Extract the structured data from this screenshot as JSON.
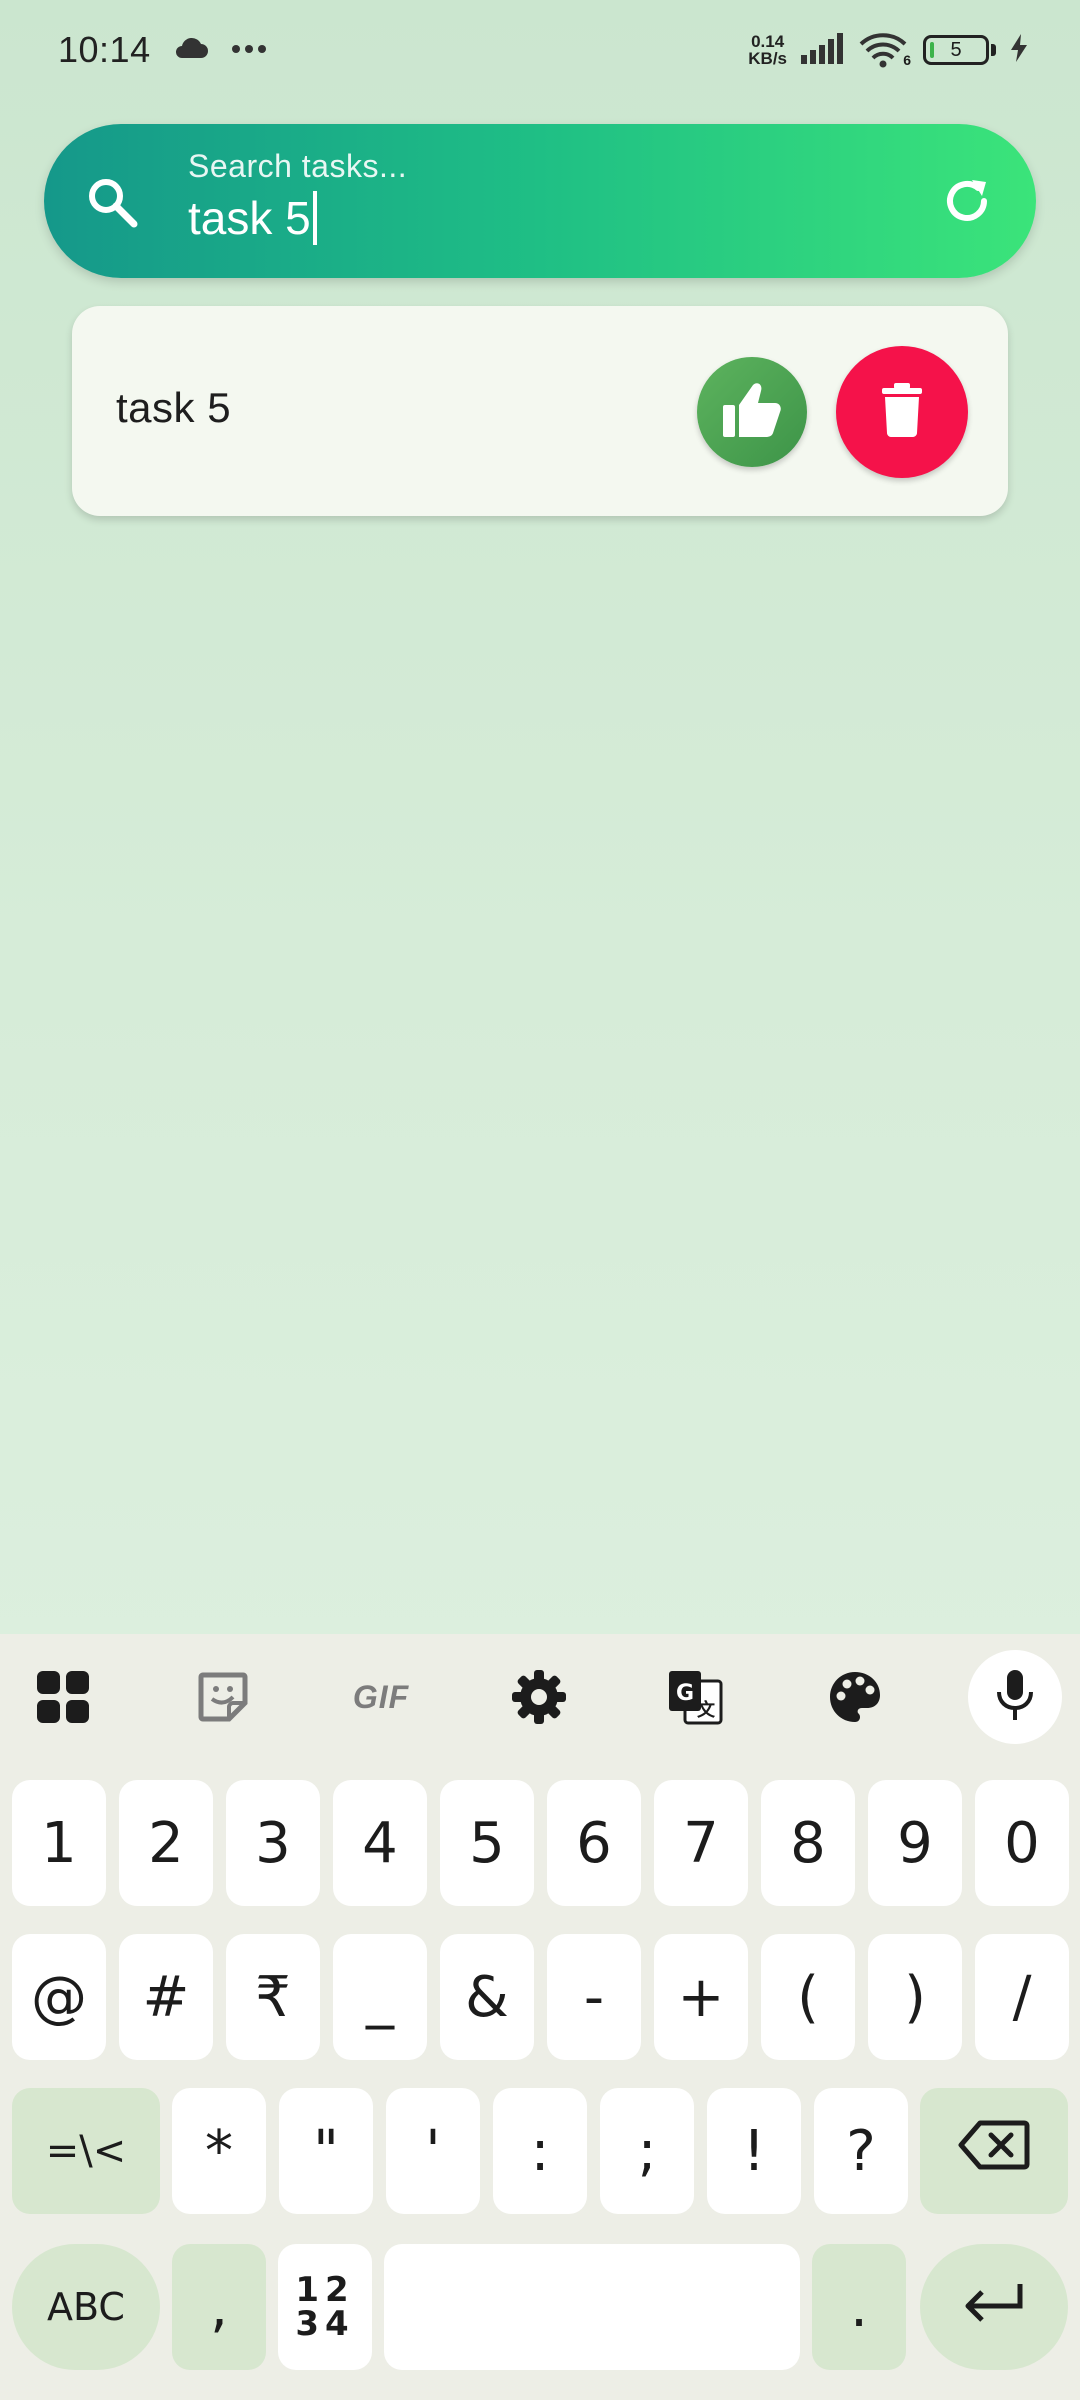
{
  "status_bar": {
    "time": "10:14",
    "net_speed_value": "0.14",
    "net_speed_unit": "KB/s",
    "wifi_label": "6",
    "battery_level": "5"
  },
  "search": {
    "placeholder": "Search tasks...",
    "value": "task 5"
  },
  "tasks": [
    {
      "title": "task 5"
    }
  ],
  "keyboard": {
    "toolbar": [
      "apps-grid-icon",
      "sticker-icon",
      "gif-icon",
      "settings-icon",
      "translate-icon",
      "palette-icon",
      "mic-icon"
    ],
    "gif_label": "GIF",
    "row1": [
      "1",
      "2",
      "3",
      "4",
      "5",
      "6",
      "7",
      "8",
      "9",
      "0"
    ],
    "row2": [
      "@",
      "#",
      "₹",
      "_",
      "&",
      "-",
      "+",
      "(",
      ")",
      "/"
    ],
    "row3": [
      "*",
      "\"",
      "'",
      ":",
      ";",
      "!",
      "?"
    ],
    "shift_label": "=\\<",
    "abc_label": "ABC",
    "comma_label": ",",
    "num_switch_top": "12",
    "num_switch_bottom": "34",
    "period_label": "."
  },
  "colors": {
    "search_gradient_start": "#15988a",
    "search_gradient_end": "#3be47a",
    "like_button": "#4ba552",
    "delete_button": "#f5124a"
  }
}
